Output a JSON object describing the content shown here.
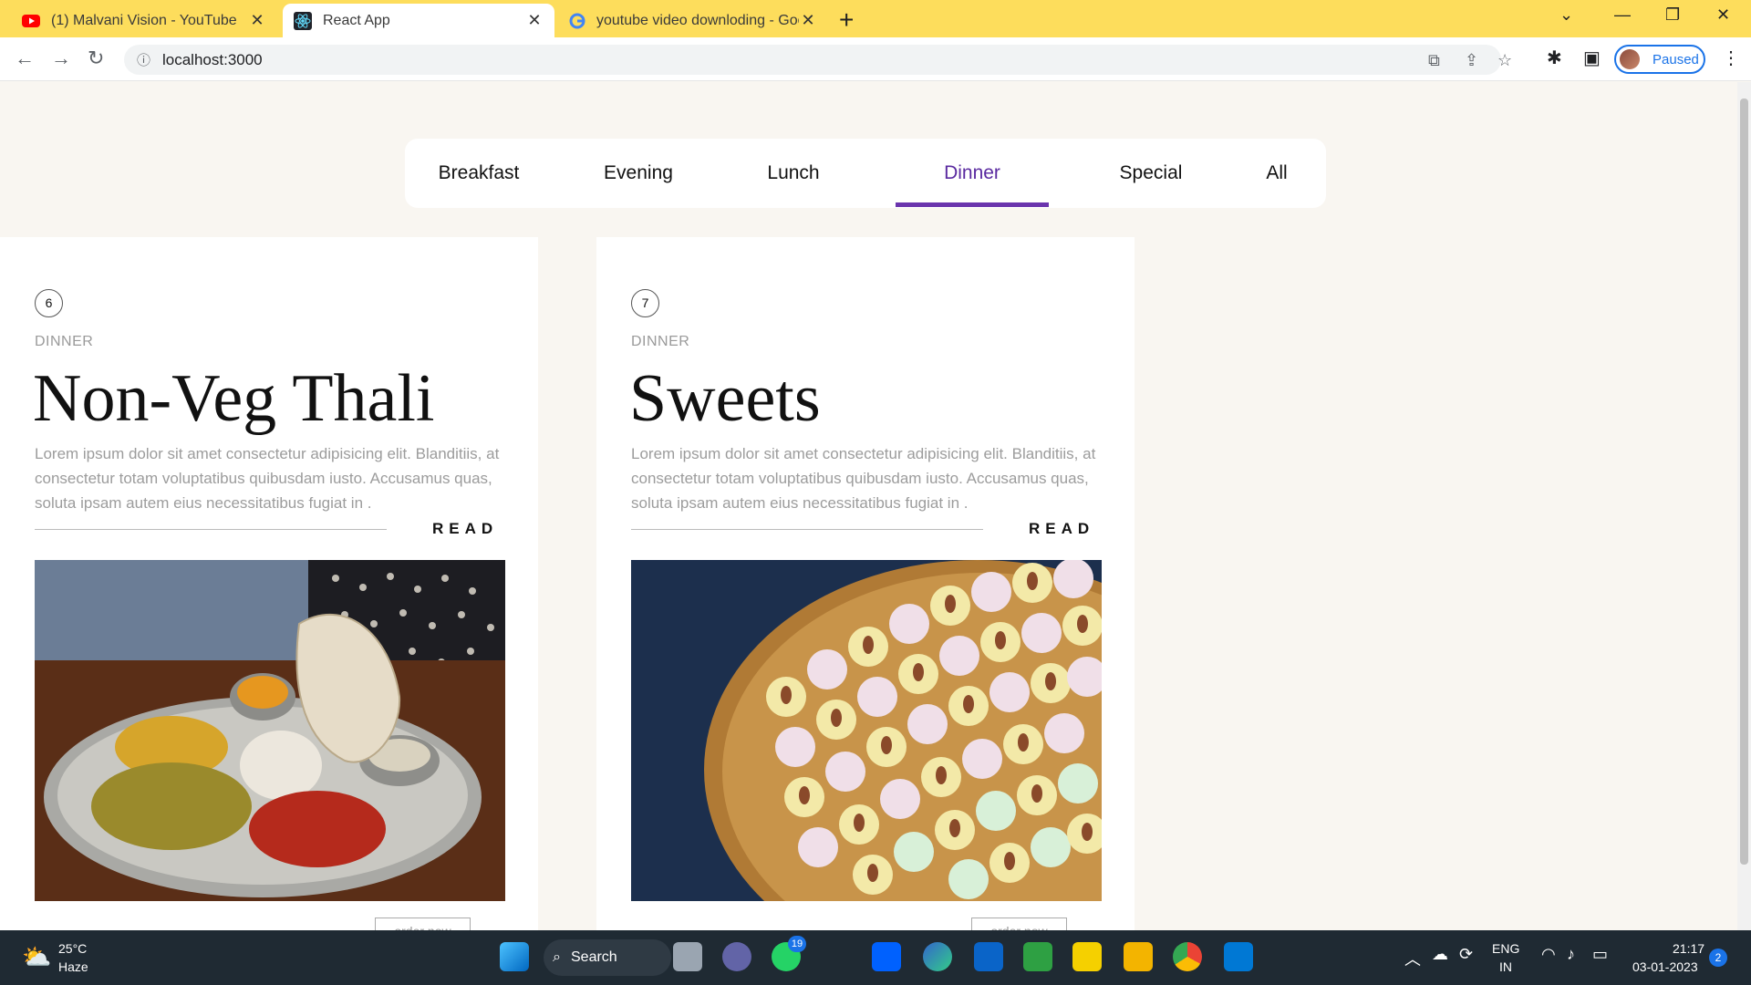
{
  "browser": {
    "tabs": [
      {
        "title": "(1) Malvani Vision - YouTube"
      },
      {
        "title": "React App"
      },
      {
        "title": "youtube video downloding - Goo"
      }
    ],
    "url": "localhost:3000",
    "profile_status": "Paused"
  },
  "menu": {
    "categories": [
      "Breakfast",
      "Evening",
      "Lunch",
      "Dinner",
      "Special",
      "All"
    ],
    "active": "Dinner"
  },
  "cards": [
    {
      "number": "6",
      "category": "DINNER",
      "title": "Non-Veg Thali",
      "description": "Lorem ipsum dolor sit amet consectetur adipisicing elit. Blanditiis, at consectetur totam voluptatibus quibusdam iusto. Accusamus quas, soluta ipsam autem eius necessitatibus fugiat in .",
      "read_label": "READ",
      "order_label": "order now"
    },
    {
      "number": "7",
      "category": "DINNER",
      "title": "Sweets",
      "description": "Lorem ipsum dolor sit amet consectetur adipisicing elit. Blanditiis, at consectetur totam voluptatibus quibusdam iusto. Accusamus quas, soluta ipsam autem eius necessitatibus fugiat in .",
      "read_label": "READ",
      "order_label": "order now"
    }
  ],
  "taskbar": {
    "weather_temp": "25°C",
    "weather_desc": "Haze",
    "search_label": "Search",
    "whatsapp_badge": "19",
    "lang": "ENG",
    "region": "IN",
    "time": "21:17",
    "date": "03-01-2023",
    "notifications": "2"
  }
}
